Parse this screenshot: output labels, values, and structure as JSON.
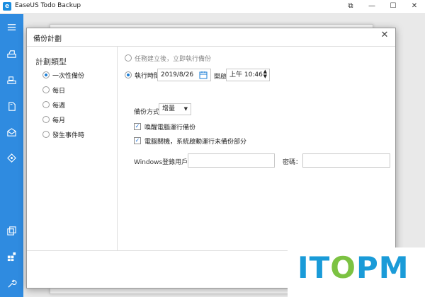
{
  "app": {
    "title": "EaseUS Todo Backup",
    "controls": {
      "restore": "⧉",
      "minimize": "—",
      "maximize": "☐",
      "close": "✕"
    }
  },
  "sidebar": {
    "items": [
      {
        "icon": "menu-icon"
      },
      {
        "icon": "disk-backup-icon"
      },
      {
        "icon": "system-backup-icon"
      },
      {
        "icon": "file-backup-icon"
      },
      {
        "icon": "mail-backup-icon"
      },
      {
        "icon": "smart-backup-icon"
      },
      {
        "icon": "clone-icon"
      },
      {
        "icon": "apps-icon"
      },
      {
        "icon": "tools-icon"
      }
    ],
    "color": "#2f8be0"
  },
  "dialog": {
    "title": "備份計劃",
    "close": "✕",
    "plan_type": {
      "heading": "計劃類型",
      "options": [
        {
          "label": "一次性備份",
          "selected": true
        },
        {
          "label": "每日",
          "selected": false
        },
        {
          "label": "每週",
          "selected": false
        },
        {
          "label": "每月",
          "selected": false
        },
        {
          "label": "發生事件時",
          "selected": false
        }
      ]
    },
    "run": {
      "immediate_label": "任務建立後，立即執行備份",
      "scheduled_label": "執行時間",
      "date": "2019/8/26",
      "start_label": "開啟",
      "time": "上午 10:46"
    },
    "backup_method": {
      "label": "備份方式",
      "value": "增量"
    },
    "wake_computer": {
      "label": "喚醒電腦運行備份",
      "checked": true
    },
    "shutdown_run": {
      "label": "電腦關機，系統啟動運行未備份部分",
      "checked": true
    },
    "windows_user": {
      "label": "Windows登錄用戶：",
      "value": ""
    },
    "password": {
      "label": "密碼：",
      "value": ""
    }
  },
  "watermark": {
    "text": "ITOPM",
    "color_main": "#1a9bd8",
    "color_accent": "#7cc242"
  },
  "colors": {
    "accent": "#1a7ed6"
  }
}
